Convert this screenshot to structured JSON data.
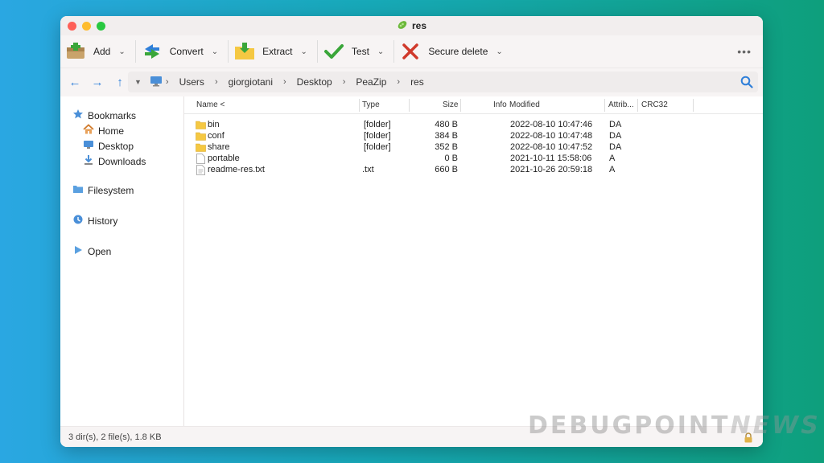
{
  "window": {
    "title": "res"
  },
  "toolbar": {
    "add_label": "Add",
    "convert_label": "Convert",
    "extract_label": "Extract",
    "test_label": "Test",
    "secure_delete_label": "Secure delete",
    "more_label": "•••"
  },
  "address": {
    "path": [
      "Users",
      "giorgiotani",
      "Desktop",
      "PeaZip",
      "res"
    ]
  },
  "sidebar": {
    "bookmarks": "Bookmarks",
    "home": "Home",
    "desktop": "Desktop",
    "downloads": "Downloads",
    "filesystem": "Filesystem",
    "history": "History",
    "open": "Open"
  },
  "columns": {
    "name": "Name <",
    "type": "Type",
    "size": "Size",
    "info": "Info",
    "modified": "Modified",
    "attrib": "Attrib...",
    "crc": "CRC32"
  },
  "files": [
    {
      "name": "bin",
      "type": "[folder]",
      "size": "480 B",
      "modified": "2022-08-10 10:47:46",
      "attrib": "DA",
      "kind": "folder"
    },
    {
      "name": "conf",
      "type": "[folder]",
      "size": "384 B",
      "modified": "2022-08-10 10:47:48",
      "attrib": "DA",
      "kind": "folder"
    },
    {
      "name": "share",
      "type": "[folder]",
      "size": "352 B",
      "modified": "2022-08-10 10:47:52",
      "attrib": "DA",
      "kind": "folder"
    },
    {
      "name": "portable",
      "type": "",
      "size": "0 B",
      "modified": "2021-10-11 15:58:06",
      "attrib": "A",
      "kind": "file"
    },
    {
      "name": "readme-res.txt",
      "type": ".txt",
      "size": "660 B",
      "modified": "2021-10-26 20:59:18",
      "attrib": "A",
      "kind": "file"
    }
  ],
  "status": {
    "text": "3 dir(s), 2 file(s), 1.8 KB"
  },
  "watermark": {
    "part1": "DEBUGPOINT",
    "part2": "NEWS"
  },
  "colors": {
    "accent": "#2f7fd9",
    "folder": "#f5c842",
    "test_check": "#3aa63a",
    "delete_x": "#d0392b"
  }
}
